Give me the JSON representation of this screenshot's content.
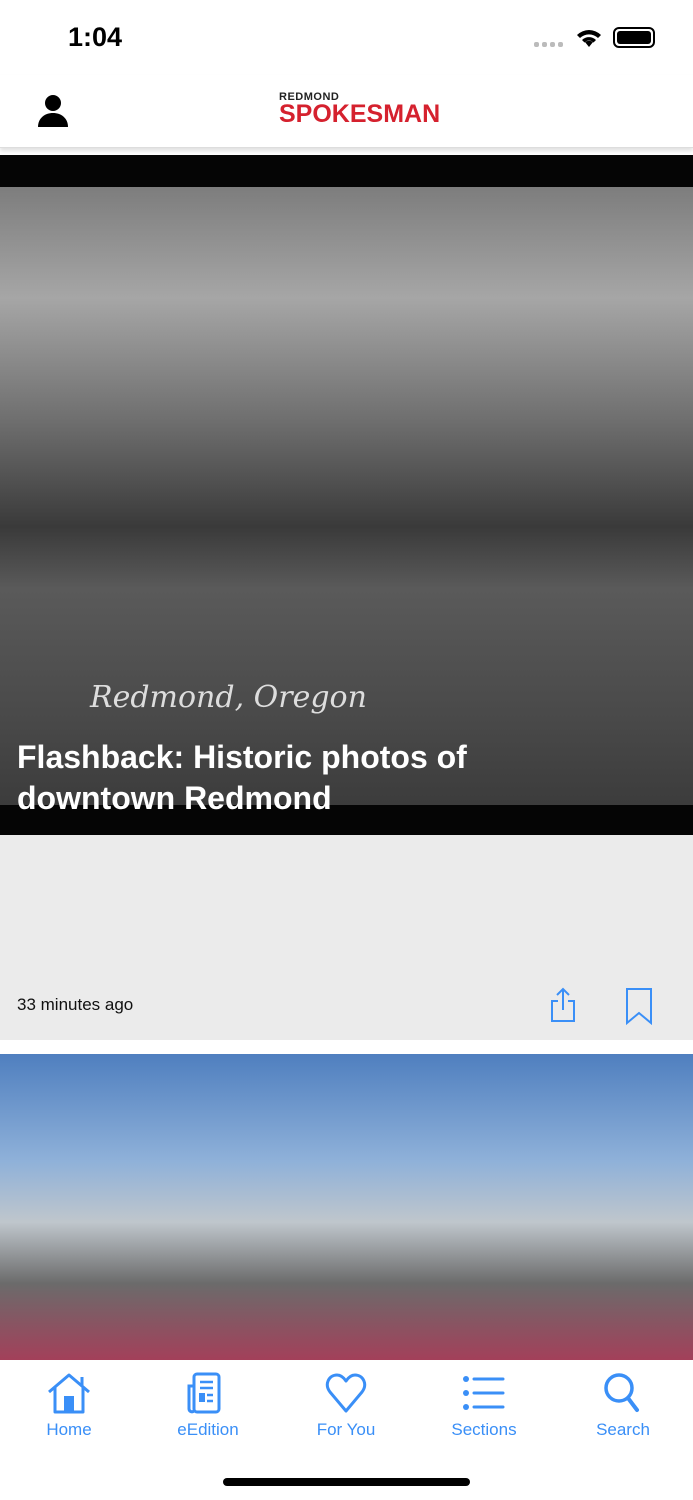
{
  "status": {
    "time": "1:04"
  },
  "header": {
    "logo_top": "REDMOND",
    "logo_main": "SPOKESMAN"
  },
  "stories": [
    {
      "title": "Flashback: Historic photos of downtown Redmond",
      "photo_caption": "Redmond, Oregon",
      "timestamp": "33 minutes ago"
    },
    {}
  ],
  "tabs": [
    {
      "label": "Home"
    },
    {
      "label": "eEdition"
    },
    {
      "label": "For You"
    },
    {
      "label": "Sections"
    },
    {
      "label": "Search"
    }
  ],
  "colors": {
    "accent": "#3a8ff7",
    "brand": "#d5212e"
  }
}
